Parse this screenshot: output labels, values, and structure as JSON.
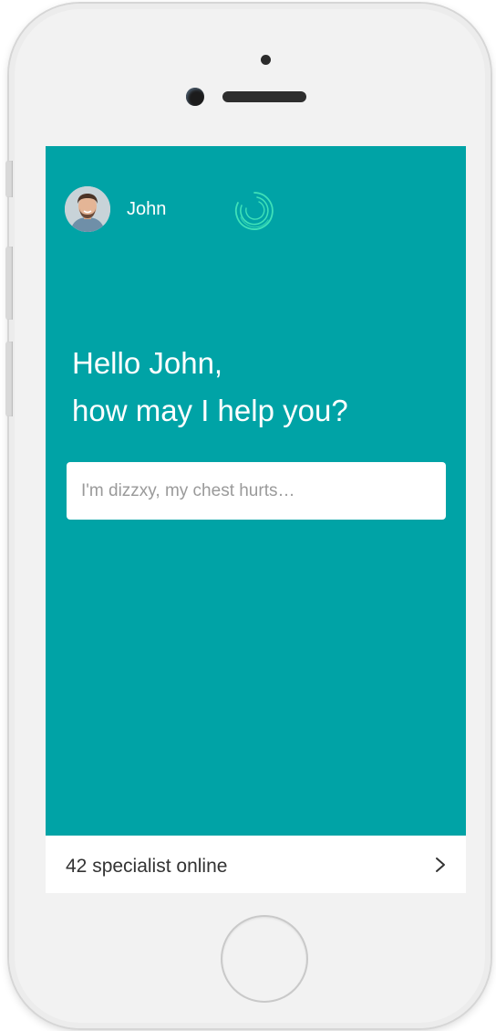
{
  "user": {
    "name": "John"
  },
  "greeting": {
    "line1": "Hello John,",
    "line2": "how may I help you?"
  },
  "search": {
    "placeholder": "I'm dizzxy, my chest hurts…"
  },
  "footer": {
    "specialists_label": "42 specialist online"
  },
  "icons": {
    "avatar": "user-avatar-photo",
    "logo": "spiral-circle-logo",
    "chevron": "chevron-right-icon"
  },
  "colors": {
    "screen_background": "#00a3a6",
    "logo_accent": "#3fe0b8",
    "text_light": "#ffffff",
    "text_dark": "#333333"
  }
}
